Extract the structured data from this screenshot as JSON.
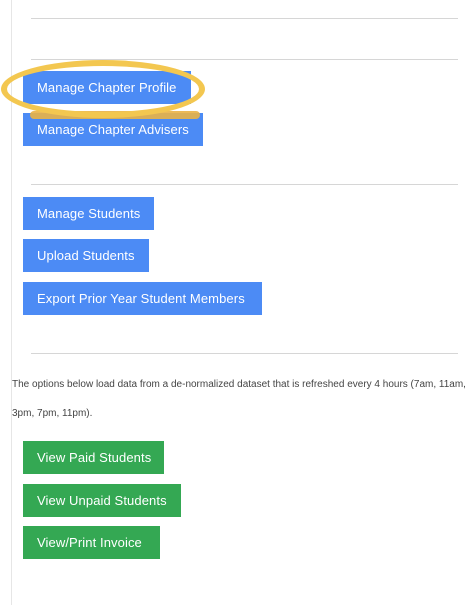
{
  "chapter_admin": {
    "manage_profile_label": "Manage Chapter Profile",
    "manage_advisers_label": "Manage Chapter Advisers",
    "manage_students_label": "Manage Students",
    "upload_students_label": "Upload Students",
    "export_prior_year_label": "Export Prior Year Student Members"
  },
  "reports": {
    "info_text": "The options below load data from a de-normalized dataset that is refreshed every 4 hours (7am, 11am, 3pm, 7pm, 11pm).",
    "view_paid_label": "View Paid Students",
    "view_unpaid_label": "View Unpaid Students",
    "print_invoice_label": "View/Print Invoice"
  },
  "colors": {
    "blue_button": "#4c8bf5",
    "green_button": "#34a853",
    "highlight": "#f3c750"
  }
}
